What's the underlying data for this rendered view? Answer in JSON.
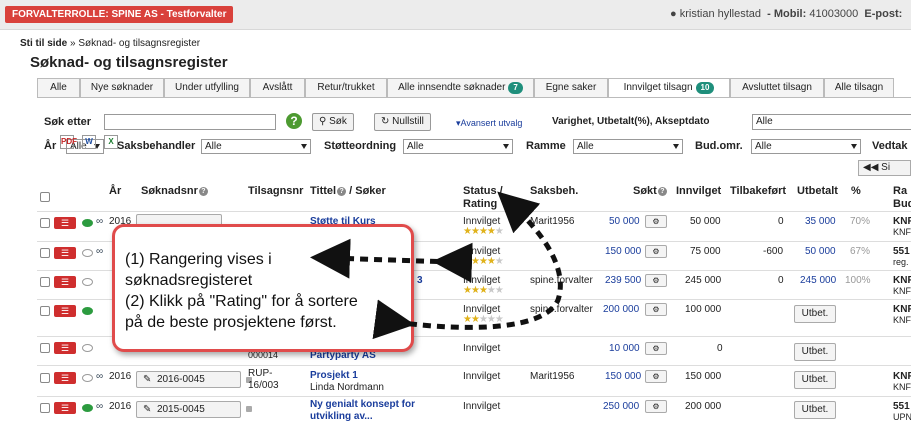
{
  "topbar": {
    "role": "FORVALTERROLLE: SPINE AS - Testforvalter",
    "user": "kristian hyllestad",
    "mobile_label": "Mobil:",
    "mobile": "41003000",
    "email_label": "E-post:"
  },
  "breadcrumb": {
    "root": "Sti til side",
    "sep": "»",
    "current": "Søknad- og tilsagnsregister"
  },
  "page_title": "Søknad- og tilsagnsregister",
  "tabs": [
    {
      "label": "Alle"
    },
    {
      "label": "Nye søknader"
    },
    {
      "label": "Under utfylling"
    },
    {
      "label": "Avslått"
    },
    {
      "label": "Retur/trukket"
    },
    {
      "label": "Alle innsendte søknader",
      "badge": "7"
    },
    {
      "label": "Egne saker"
    },
    {
      "label": "Innvilget tilsagn",
      "badge": "10"
    },
    {
      "label": "Avsluttet tilsagn"
    },
    {
      "label": "Alle tilsagn"
    }
  ],
  "search": {
    "label": "Søk etter",
    "value": "",
    "help": "?",
    "search_button": "Søk",
    "reset_button": "Nullstill",
    "advanced": "Avansert utvalg",
    "duration_label": "Varighet, Utbetalt(%), Akseptdato",
    "duration_value": "Alle"
  },
  "filters": {
    "year": {
      "label": "År",
      "value": "Alle"
    },
    "caseworker": {
      "label": "Saksbehandler",
      "value": "Alle"
    },
    "scheme": {
      "label": "Støtteordning",
      "value": "Alle"
    },
    "frame": {
      "label": "Ramme",
      "value": "Alle"
    },
    "budget": {
      "label": "Bud.omr.",
      "value": "Alle"
    },
    "decision": {
      "label": "Vedtak"
    }
  },
  "export": {
    "pdf": "PDF",
    "word": "W",
    "excel": "X"
  },
  "pager": {
    "label": "Si"
  },
  "columns": {
    "year": "År",
    "appno": "Søknadsnr",
    "grantno": "Tilsagnsnr",
    "title": "Tittel",
    "applicant": "/ Søker",
    "status": "Status /",
    "rating": "Rating",
    "caseworker": "Saksbeh.",
    "applied": "Søkt",
    "granted": "Innvilget",
    "returned": "Tilbakeført",
    "paid": "Utbetalt",
    "pct": "%",
    "ra": "Ra",
    "bud": "Bud"
  },
  "rows": [
    {
      "year": "2016",
      "title": "Støtte til Kurs",
      "status": "Innvilget",
      "rating": 4,
      "caseworker": "Marit1956",
      "applied": "50 000",
      "granted": "50 000",
      "returned": "0",
      "paid": "35 000",
      "pct": "70%",
      "ra": "KNF",
      "bud": "KNF"
    },
    {
      "status": "Innvilget",
      "rating": 4,
      "applied": "150 000",
      "granted": "75 000",
      "returned": "-600",
      "paid": "50 000",
      "pct": "67%",
      "ra": "551",
      "bud": "reg."
    },
    {
      "grant_partial": "3",
      "status": "Innvilget",
      "rating": 3,
      "caseworker": "spine.forvalter",
      "applied": "239 500",
      "granted": "245 000",
      "returned": "0",
      "paid": "245 000",
      "pct": "100%",
      "ra": "KNF",
      "bud": "KNF"
    },
    {
      "status": "Innvilget",
      "rating": 2,
      "caseworker": "spine.forvalter",
      "applied": "200 000",
      "granted": "100 000",
      "paid_button": "Utbet.",
      "ra": "KNF",
      "bud": "KNF"
    },
    {
      "grantno_partial": "000014",
      "applicant": "Partyparty AS",
      "status": "Innvilget",
      "applied": "10 000",
      "granted": "0",
      "paid_button": "Utbet."
    },
    {
      "year": "2016",
      "appno": "2016-0045",
      "grantno": "RUP-16/003",
      "title": "Prosjekt 1",
      "applicant": "Linda Nordmann",
      "status": "Innvilget",
      "caseworker": "Marit1956",
      "applied": "150 000",
      "granted": "150 000",
      "paid_button": "Utbet.",
      "ra": "KNF",
      "bud": "KNF"
    },
    {
      "year": "2016",
      "appno": "2015-0045",
      "title": "Ny genialt konsept for utvikling av...",
      "status": "Innvilget",
      "applied": "250 000",
      "granted": "200 000",
      "paid_button": "Utbet.",
      "ra": "551",
      "bud": "UPN"
    }
  ],
  "callout": {
    "line1": "(1) Rangering vises i",
    "line2": "søknadsregisteret",
    "line3": "(2) Klikk på \"Rating\" for å sortere",
    "line4": "på de beste prosjektene først."
  }
}
